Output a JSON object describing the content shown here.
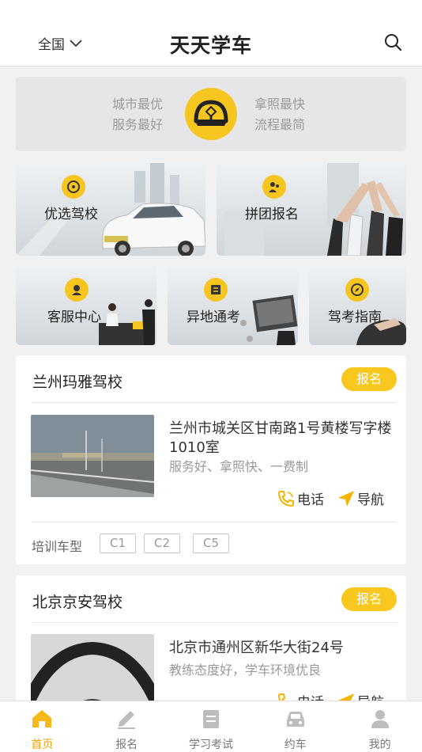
{
  "header": {
    "region": "全国",
    "title": "天天学车"
  },
  "banner": {
    "left_line1": "城市最优",
    "left_line2": "服务最好",
    "right_line1": "拿照最快",
    "right_line2": "流程最简"
  },
  "features": [
    {
      "label": "优选驾校"
    },
    {
      "label": "拼团报名"
    },
    {
      "label": "客服中心"
    },
    {
      "label": "异地通考"
    },
    {
      "label": "驾考指南"
    }
  ],
  "schools": [
    {
      "name": "兰州玛雅驾校",
      "enroll_label": "报名",
      "address": "兰州市城关区甘南路1号黄楼写字楼1010室",
      "features": "服务好、拿照快、一费制",
      "phone_label": "电话",
      "nav_label": "导航",
      "train_title": "培训车型",
      "car_types": [
        "C1",
        "C2",
        "C5"
      ]
    },
    {
      "name": "北京京安驾校",
      "enroll_label": "报名",
      "address": "北京市通州区新华大街24号",
      "features": "教练态度好，学车环境优良",
      "phone_label": "电话",
      "nav_label": "导航"
    }
  ],
  "tabbar": {
    "tabs": [
      {
        "label": "首页",
        "active": true
      },
      {
        "label": "报名"
      },
      {
        "label": "学习考试"
      },
      {
        "label": "约车"
      },
      {
        "label": "我的"
      }
    ]
  },
  "colors": {
    "accent": "#f7c51f",
    "active_tab": "#f2a516"
  }
}
